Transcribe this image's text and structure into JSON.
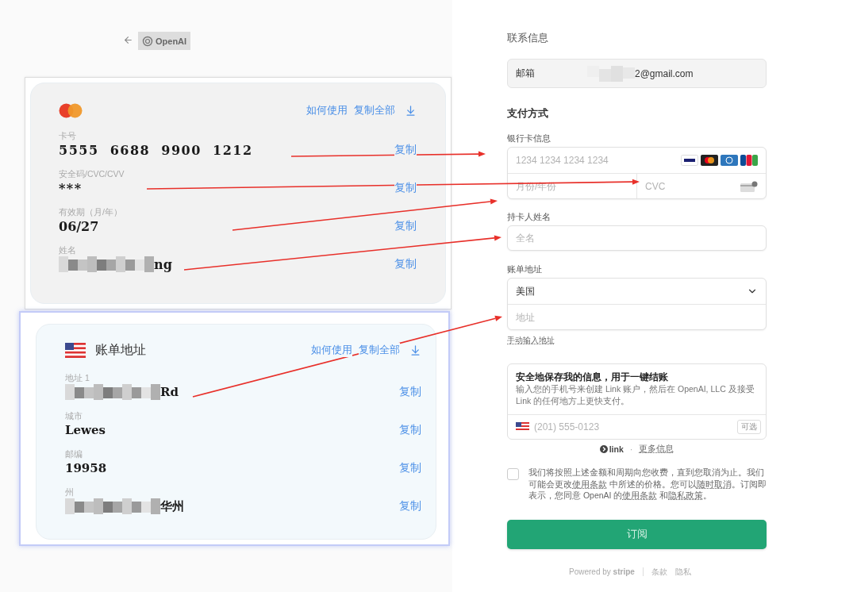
{
  "header": {
    "logo_text": "OpenAI"
  },
  "card_panel": {
    "actions": [
      "如何使用",
      "复制全部"
    ],
    "fields": [
      {
        "label": "卡号",
        "value": "5555  6688  9900  1212",
        "copy": "复制",
        "redacted": false
      },
      {
        "label": "安全码/CVC/CVV",
        "value": "***",
        "copy": "复制",
        "redacted": false
      },
      {
        "label": "有效期（月/年）",
        "value": "06/27",
        "copy": "复制",
        "redacted": false
      },
      {
        "label": "姓名",
        "value": "ng",
        "copy": "复制",
        "redacted": true
      }
    ]
  },
  "address_panel": {
    "title": "账单地址",
    "actions": [
      "如何使用",
      "复制全部"
    ],
    "fields": [
      {
        "label": "地址 1",
        "value": "Rd",
        "copy": "复制",
        "redacted": true
      },
      {
        "label": "城市",
        "value": "Lewes",
        "copy": "复制",
        "redacted": false
      },
      {
        "label": "邮编",
        "value": "19958",
        "copy": "复制",
        "redacted": false
      },
      {
        "label": "州",
        "value": "华州",
        "copy": "复制",
        "redacted": true
      }
    ]
  },
  "checkout": {
    "contact_heading": "联系信息",
    "email": {
      "label": "邮箱",
      "value": "2@gmail.com",
      "redacted": true
    },
    "payment_heading": "支付方式",
    "card_label": "银行卡信息",
    "card_number_placeholder": "1234 1234 1234 1234",
    "expiry_placeholder": "月份/年份",
    "cvc_placeholder": "CVC",
    "name_label": "持卡人姓名",
    "name_placeholder": "全名",
    "address_label": "账单地址",
    "country": "美国",
    "address_placeholder": "地址",
    "manual_link": "手动输入地址",
    "link_box": {
      "title": "安全地保存我的信息，用于一键结账",
      "description": "输入您的手机号来创建 Link 账户，然后在 OpenAI, LLC 及接受 Link 的任何地方上更快支付。",
      "phone_placeholder": "(201) 555-0123",
      "optional": "可选"
    },
    "link_row": {
      "brand": "link",
      "separator": "·",
      "more": "更多信息"
    },
    "consent": {
      "checked": false,
      "segments": [
        {
          "text": "我们将按照上述金额和周期向您收费，直到您取消为止。我们可能会更改",
          "link": false
        },
        {
          "text": "使用条款",
          "link": true
        },
        {
          "text": " 中所述的价格。您可以",
          "link": false
        },
        {
          "text": "随时取消",
          "link": true
        },
        {
          "text": "。订阅即表示，您同意 OpenAI 的",
          "link": false
        },
        {
          "text": "使用条款",
          "link": true
        },
        {
          "text": " 和",
          "link": false
        },
        {
          "text": "隐私政策",
          "link": true
        },
        {
          "text": "。",
          "link": false
        }
      ]
    },
    "subscribe": "订阅",
    "footer": {
      "powered": "Powered by **stripe**",
      "links": [
        "条款",
        "隐私"
      ]
    }
  }
}
